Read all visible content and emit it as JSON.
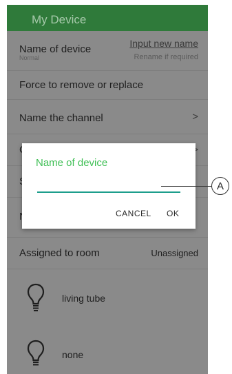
{
  "header": {
    "title": "My Device"
  },
  "name_row": {
    "label": "Name of device",
    "sub": "Normal",
    "link": "Input new name",
    "hint": "Rename if required"
  },
  "force_row": {
    "label": "Force to remove or replace"
  },
  "channel_row": {
    "label": "Name the channel",
    "chevron": ">"
  },
  "room_row": {
    "label": "Assigned to room",
    "value": "Unassigned"
  },
  "lights": [
    {
      "name": "living tube",
      "icon": "lightbulb-icon"
    },
    {
      "name": "none",
      "icon": "lightbulb-icon"
    }
  ],
  "dialog": {
    "title": "Name of device",
    "input_value": "",
    "cancel": "CANCEL",
    "ok": "OK"
  },
  "callout": {
    "letter": "A"
  },
  "colors": {
    "header": "#2f7a3a",
    "dim_overlay": "#8a8a8a",
    "dialog_title": "#3fbf55",
    "input_underline": "#1d9e8c"
  }
}
